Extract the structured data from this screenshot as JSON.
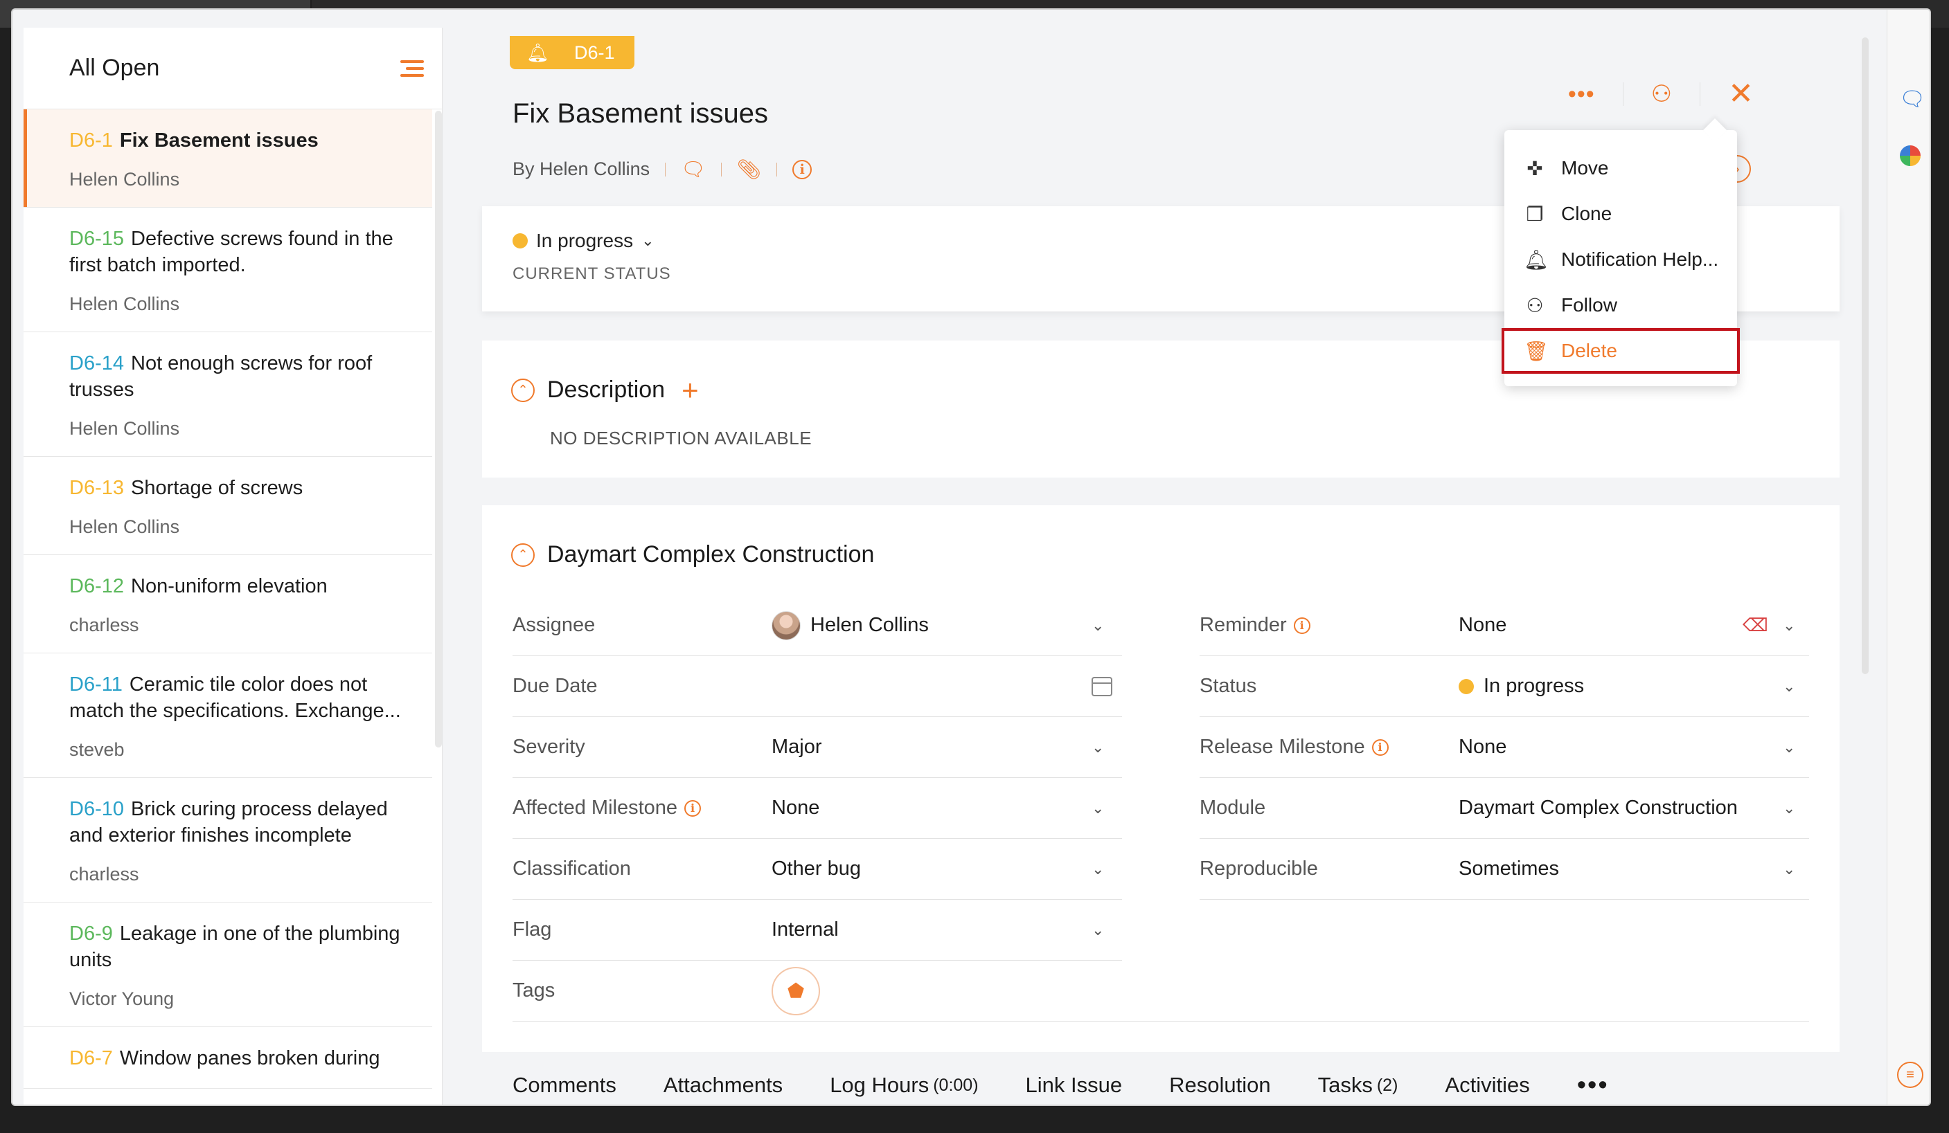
{
  "left_panel": {
    "title": "All Open",
    "issues": [
      {
        "id": "D6-1",
        "title": "Fix Basement issues",
        "owner": "Helen Collins",
        "id_color": "#f7b731",
        "active": true
      },
      {
        "id": "D6-15",
        "title": "Defective screws found in the first batch imported.",
        "owner": "Helen Collins",
        "id_color": "#5cb85c",
        "active": false
      },
      {
        "id": "D6-14",
        "title": "Not enough screws for roof trusses",
        "owner": "Helen Collins",
        "id_color": "#2aa1c9",
        "active": false
      },
      {
        "id": "D6-13",
        "title": "Shortage of screws",
        "owner": "Helen Collins",
        "id_color": "#f7b731",
        "active": false
      },
      {
        "id": "D6-12",
        "title": "Non-uniform elevation",
        "owner": "charless",
        "id_color": "#5cb85c",
        "active": false
      },
      {
        "id": "D6-11",
        "title": "Ceramic tile color does not match the specifications. Exchange...",
        "owner": "steveb",
        "id_color": "#2aa1c9",
        "active": false
      },
      {
        "id": "D6-10",
        "title": "Brick curing process delayed and exterior finishes incomplete",
        "owner": "charless",
        "id_color": "#2aa1c9",
        "active": false
      },
      {
        "id": "D6-9",
        "title": "Leakage in one of the plumbing units",
        "owner": "Victor Young",
        "id_color": "#5cb85c",
        "active": false
      },
      {
        "id": "D6-7",
        "title": "Window panes broken during",
        "owner": "",
        "id_color": "#f7b731",
        "active": false
      }
    ]
  },
  "detail": {
    "id_badge": "D6-1",
    "title": "Fix Basement issues",
    "byline": "By Helen Collins",
    "status": {
      "value": "In progress",
      "label": "CURRENT STATUS"
    },
    "description": {
      "title": "Description",
      "empty_text": "NO DESCRIPTION AVAILABLE"
    },
    "section_title": "Daymart Complex Construction",
    "fields_left": [
      {
        "label": "Assignee",
        "value": "Helen Collins"
      },
      {
        "label": "Due Date",
        "value": ""
      },
      {
        "label": "Severity",
        "value": "Major"
      },
      {
        "label": "Affected Milestone",
        "value": "None"
      },
      {
        "label": "Classification",
        "value": "Other bug"
      },
      {
        "label": "Flag",
        "value": "Internal"
      },
      {
        "label": "Tags",
        "value": ""
      }
    ],
    "fields_right": [
      {
        "label": "Reminder",
        "value": "None"
      },
      {
        "label": "Status",
        "value": "In progress"
      },
      {
        "label": "Release Milestone",
        "value": "None"
      },
      {
        "label": "Module",
        "value": "Daymart Complex Construction"
      },
      {
        "label": "Reproducible",
        "value": "Sometimes"
      }
    ],
    "tabs": [
      {
        "label": "Comments",
        "count": ""
      },
      {
        "label": "Attachments",
        "count": ""
      },
      {
        "label": "Log Hours",
        "count": "(0:00)"
      },
      {
        "label": "Link Issue",
        "count": ""
      },
      {
        "label": "Resolution",
        "count": ""
      },
      {
        "label": "Tasks",
        "count": "(2)"
      },
      {
        "label": "Activities",
        "count": ""
      }
    ]
  },
  "context_menu": {
    "items": [
      {
        "label": "Move",
        "icon": "move-icon"
      },
      {
        "label": "Clone",
        "icon": "clone-icon"
      },
      {
        "label": "Notification Help...",
        "icon": "bell-icon"
      },
      {
        "label": "Follow",
        "icon": "follow-user-icon"
      },
      {
        "label": "Delete",
        "icon": "trash-icon"
      }
    ]
  },
  "colors": {
    "accent": "#f07a2c",
    "status_in_progress": "#f7b731",
    "highlight_border": "#c2141c"
  }
}
